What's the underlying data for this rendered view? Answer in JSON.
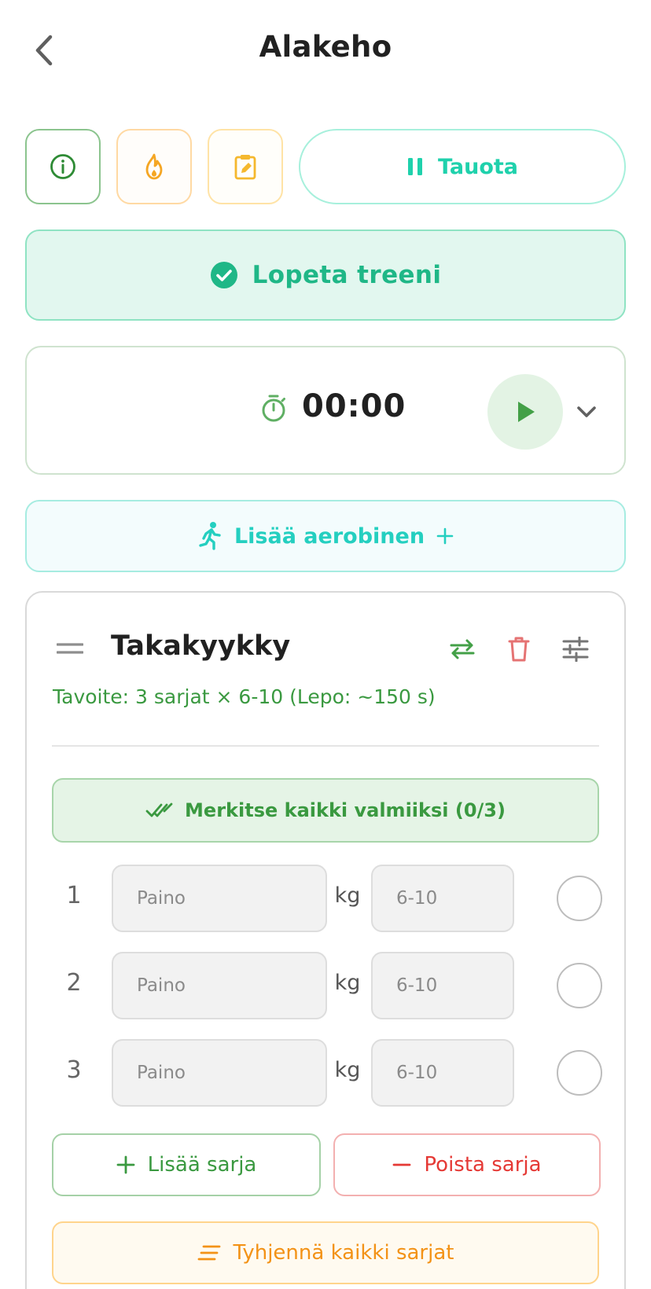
{
  "header": {
    "title": "Alakeho",
    "back_icon": "chevron-left-icon"
  },
  "toolbar": {
    "info_icon": "info-icon",
    "warmup_icon": "flame-icon",
    "notes_icon": "clipboard-edit-icon",
    "pause_label": "Tauota"
  },
  "finish": {
    "label": "Lopeta treeni",
    "icon": "check-circle-icon"
  },
  "rest_timer": {
    "value": "00:00",
    "icon": "stopwatch-icon",
    "play_icon": "play-icon",
    "expand_icon": "chevron-down-icon"
  },
  "cardio": {
    "label": "Lisää aerobinen",
    "icon": "running-icon",
    "plus_icon": "plus-icon"
  },
  "exercise": {
    "name": "Takakyykky",
    "target": "Tavoite: 3 sarjat × 6-10 (Lepo: ~150 s)",
    "mark_all_label": "Merkitse kaikki valmiiksi (0/3)",
    "sets": [
      {
        "number": "1",
        "weight_placeholder": "Paino",
        "unit": "kg",
        "reps_placeholder": "6-10",
        "done": false
      },
      {
        "number": "2",
        "weight_placeholder": "Paino",
        "unit": "kg",
        "reps_placeholder": "6-10",
        "done": false
      },
      {
        "number": "3",
        "weight_placeholder": "Paino",
        "unit": "kg",
        "reps_placeholder": "6-10",
        "done": false
      }
    ],
    "add_set_label": "Lisää sarja",
    "remove_set_label": "Poista sarja",
    "clear_sets_label": "Tyhjennä kaikki sarjat"
  },
  "colors": {
    "primary_green": "#3a9940",
    "teal": "#1fd1ac",
    "danger_red": "#e53935",
    "warning_orange": "#f39216",
    "warmup_orange": "#f5a623",
    "notes_yellow": "#f5b82e"
  }
}
